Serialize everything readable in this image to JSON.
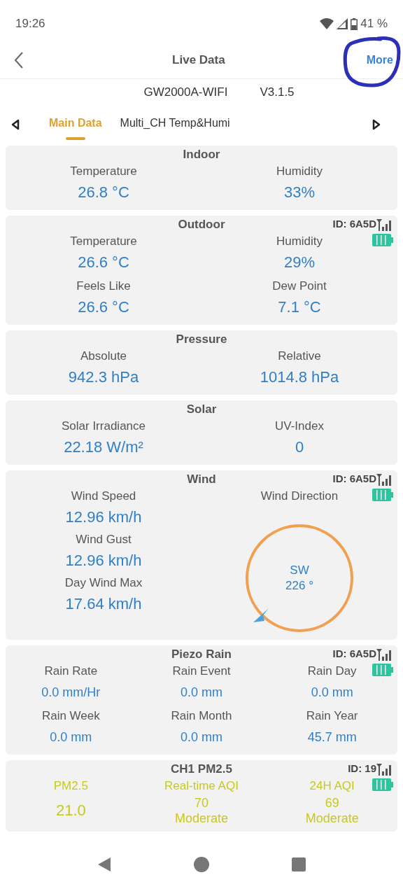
{
  "status_bar": {
    "time": "19:26",
    "battery": "41 %"
  },
  "header": {
    "title": "Live Data",
    "action": "More"
  },
  "device": {
    "model": "GW2000A-WIFI",
    "version": "V3.1.5"
  },
  "tabs": [
    {
      "label": "Main Data",
      "selected": true
    },
    {
      "label": "Multi_CH Temp&Humi",
      "selected": false
    }
  ],
  "cards": [
    {
      "kind": "grid",
      "title": "Indoor",
      "cells": [
        {
          "label": "Temperature",
          "value": "26.8 °C"
        },
        {
          "label": "Humidity",
          "value": "33%"
        }
      ]
    },
    {
      "kind": "grid",
      "title": "Outdoor",
      "sensor": {
        "id": "ID: 6A5D"
      },
      "cells": [
        {
          "label": "Temperature",
          "value": "26.6 °C"
        },
        {
          "label": "Humidity",
          "value": "29%"
        },
        {
          "label": "Feels Like",
          "value": "26.6 °C"
        },
        {
          "label": "Dew Point",
          "value": "7.1 °C"
        }
      ]
    },
    {
      "kind": "grid",
      "title": "Pressure",
      "cells": [
        {
          "label": "Absolute",
          "value": "942.3 hPa"
        },
        {
          "label": "Relative",
          "value": "1014.8 hPa"
        }
      ]
    },
    {
      "kind": "grid",
      "title": "Solar",
      "cells": [
        {
          "label": "Solar Irradiance",
          "value": "22.18 W/m²"
        },
        {
          "label": "UV-Index",
          "value": "0"
        }
      ]
    },
    {
      "kind": "wind",
      "title": "Wind",
      "sensor": {
        "id": "ID: 6A5D"
      },
      "cells": [
        {
          "label": "Wind Speed",
          "value": "12.96 km/h"
        },
        {
          "label": "Wind Gust",
          "value": "12.96 km/h"
        },
        {
          "label": "Day Wind Max",
          "value": "17.64 km/h"
        }
      ],
      "direction": {
        "label": "Wind Direction",
        "heading": "SW",
        "degrees": "226 °"
      }
    },
    {
      "kind": "rain",
      "title": "Piezo Rain",
      "sensor": {
        "id": "ID: 6A5D"
      },
      "cells": [
        {
          "label": "Rain Rate",
          "value": "0.0 mm/Hr"
        },
        {
          "label": "Rain Event",
          "value": "0.0 mm"
        },
        {
          "label": "Rain Day",
          "value": "0.0 mm"
        },
        {
          "label": "Rain Week",
          "value": "0.0 mm"
        },
        {
          "label": "Rain Month",
          "value": "0.0 mm"
        },
        {
          "label": "Rain Year",
          "value": "45.7 mm"
        }
      ]
    },
    {
      "kind": "air",
      "title": "CH1 PM2.5",
      "sensor": {
        "id": "ID: 19"
      },
      "cells": [
        {
          "label": "PM2.5",
          "value": "21.0"
        },
        {
          "label": "Real-time AQI",
          "value": "70",
          "rating": "Moderate"
        },
        {
          "label": "24H AQI",
          "value": "69",
          "rating": "Moderate"
        }
      ]
    }
  ]
}
